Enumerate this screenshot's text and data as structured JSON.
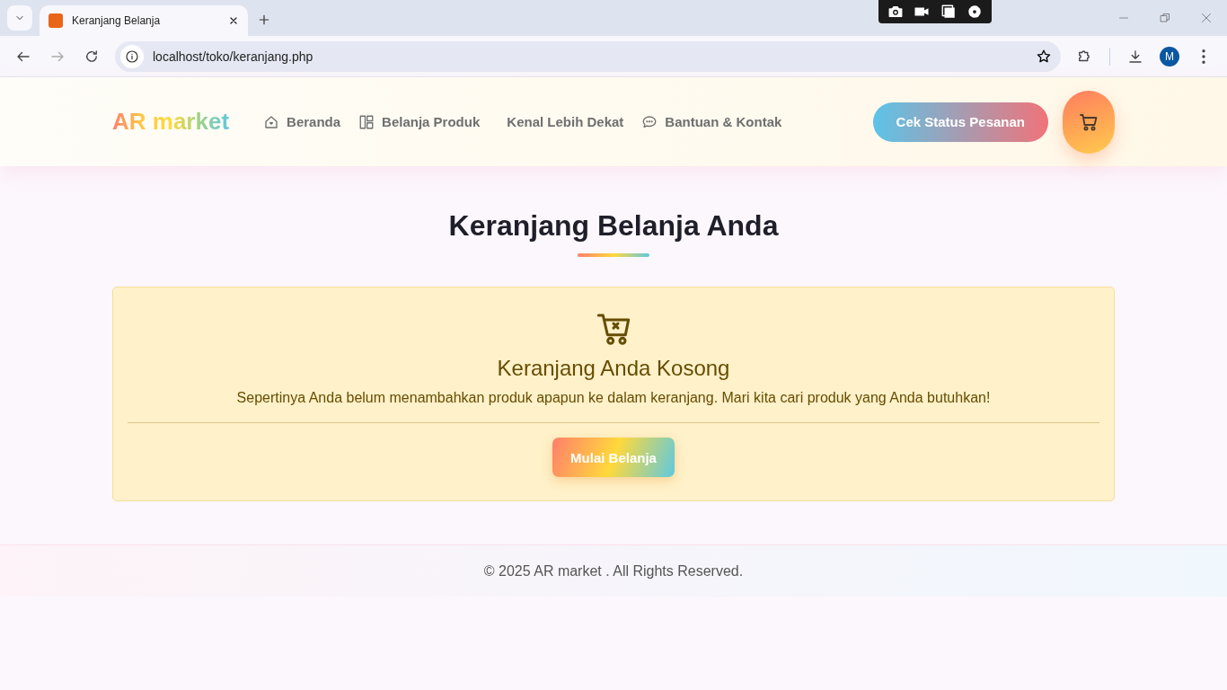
{
  "browser": {
    "tab_title": "Keranjang Belanja",
    "url": "localhost/toko/keranjang.php",
    "profile_initial": "M"
  },
  "nav": {
    "logo": "AR market",
    "links": [
      {
        "label": "Beranda",
        "kind": "home"
      },
      {
        "label": "Belanja Produk",
        "kind": "products"
      },
      {
        "label": "Kenal Lebih Dekat",
        "kind": "about"
      },
      {
        "label": "Bantuan & Kontak",
        "kind": "help"
      }
    ],
    "status_button": "Cek Status Pesanan"
  },
  "page": {
    "title": "Keranjang Belanja Anda",
    "empty_card": {
      "heading": "Keranjang Anda Kosong",
      "message": "Sepertinya Anda belum menambahkan produk apapun ke dalam keranjang. Mari kita cari produk yang Anda butuhkan!",
      "button": "Mulai Belanja"
    }
  },
  "footer": "© 2025 AR market . All Rights Reserved."
}
